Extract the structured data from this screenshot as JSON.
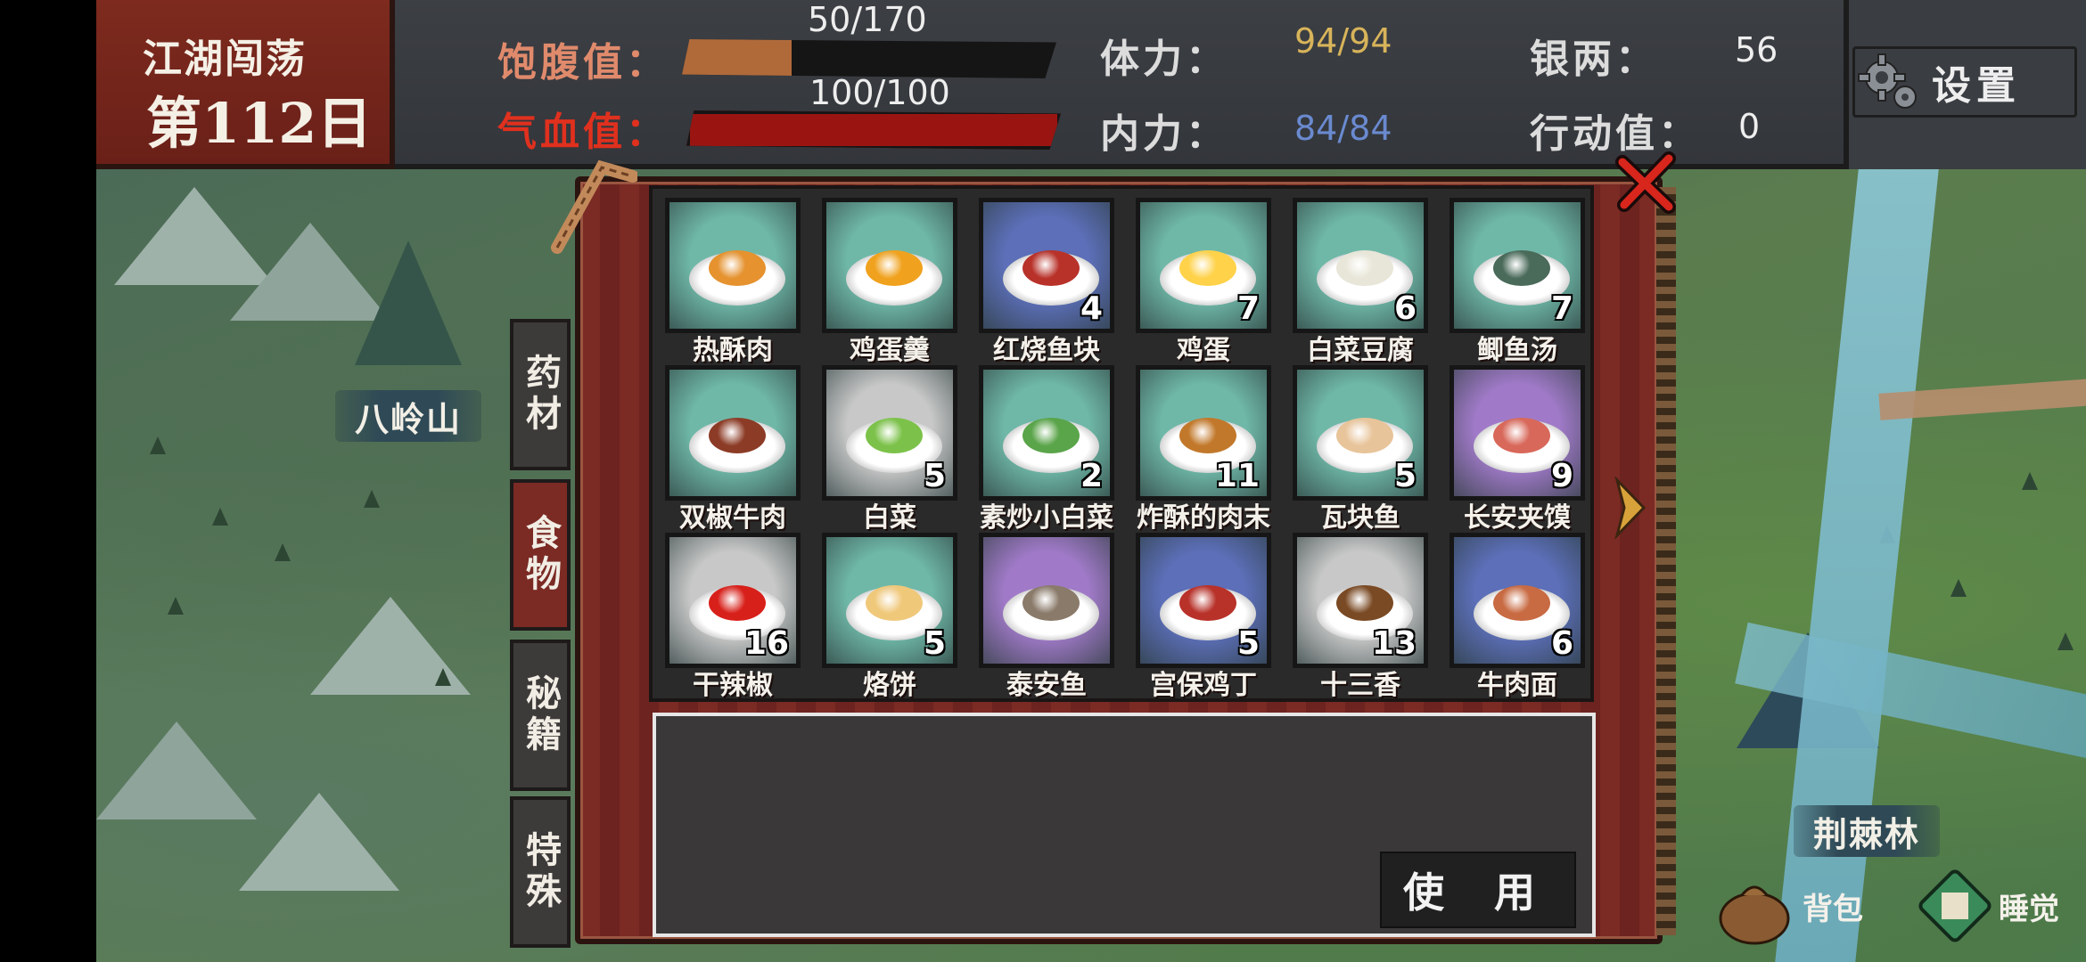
{
  "hud": {
    "region": "江湖闯荡",
    "day": "第112日",
    "satiety_label": "饱腹值：",
    "satiety_value": "50/170",
    "satiety_fraction": 0.294,
    "hp_label": "气血值：",
    "hp_value": "100/100",
    "hp_fraction": 1.0,
    "stamina_label": "体力：",
    "stamina_value": "94/94",
    "inner_label": "内力：",
    "inner_value": "84/84",
    "silver_label": "银两：",
    "silver_value": "56",
    "action_label": "行动值：",
    "action_value": "0",
    "settings_label": "设置"
  },
  "map": {
    "labels": [
      "八岭山",
      "荆棘林"
    ]
  },
  "tabs": [
    "药材",
    "食物",
    "秘籍",
    "特殊"
  ],
  "active_tab": "食物",
  "items": [
    {
      "name": "热酥肉",
      "count": "",
      "bg": "#6fb8a8",
      "food": "#e5922f"
    },
    {
      "name": "鸡蛋羹",
      "count": "",
      "bg": "#6fb8a8",
      "food": "#f0a21e"
    },
    {
      "name": "红烧鱼块",
      "count": "4",
      "bg": "#5c6fb8",
      "food": "#b8322a"
    },
    {
      "name": "鸡蛋",
      "count": "7",
      "bg": "#6fb8a8",
      "food": "#ffd24a"
    },
    {
      "name": "白菜豆腐",
      "count": "6",
      "bg": "#6fb8a8",
      "food": "#e8e6d8"
    },
    {
      "name": "鲫鱼汤",
      "count": "7",
      "bg": "#6fb8a8",
      "food": "#4a6a5a"
    },
    {
      "name": "双椒牛肉",
      "count": "",
      "bg": "#6fb8a8",
      "food": "#8c3b26"
    },
    {
      "name": "白菜",
      "count": "5",
      "bg": "#c8c8c8",
      "food": "#7cc24a"
    },
    {
      "name": "素炒小白菜",
      "count": "2",
      "bg": "#6fb8a8",
      "food": "#5aa44a"
    },
    {
      "name": "炸酥的肉末",
      "count": "11",
      "bg": "#6fb8a8",
      "food": "#c2782a"
    },
    {
      "name": "瓦块鱼",
      "count": "5",
      "bg": "#6fb8a8",
      "food": "#e8c49a"
    },
    {
      "name": "长安夹馍",
      "count": "9",
      "bg": "#a07ac8",
      "food": "#d8685a"
    },
    {
      "name": "干辣椒",
      "count": "16",
      "bg": "#c8c8c8",
      "food": "#d8201a"
    },
    {
      "name": "烙饼",
      "count": "5",
      "bg": "#6fb8a8",
      "food": "#f0c87a"
    },
    {
      "name": "泰安鱼",
      "count": "",
      "bg": "#a07ac8",
      "food": "#8a7a6a"
    },
    {
      "name": "宫保鸡丁",
      "count": "5",
      "bg": "#5c6fb8",
      "food": "#b8322a"
    },
    {
      "name": "十三香",
      "count": "13",
      "bg": "#c8c8c8",
      "food": "#7a4a24"
    },
    {
      "name": "牛肉面",
      "count": "6",
      "bg": "#5c6fb8",
      "food": "#c86a42"
    }
  ],
  "use_button": "使 用",
  "bottom": {
    "bag_label": "背包",
    "sleep_label": "睡觉"
  }
}
